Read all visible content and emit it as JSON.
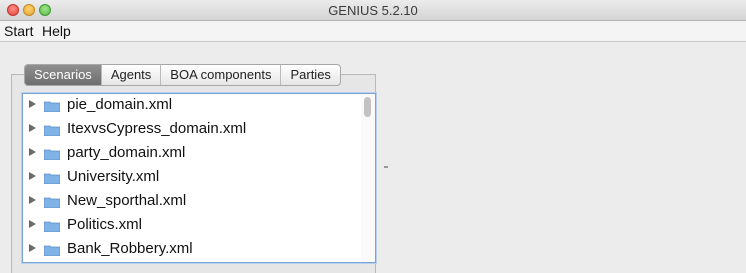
{
  "window": {
    "title": "GENIUS 5.2.10"
  },
  "menubar": {
    "items": [
      "Start",
      "Help"
    ]
  },
  "tabs": [
    {
      "label": "Scenarios",
      "active": true
    },
    {
      "label": "Agents",
      "active": false
    },
    {
      "label": "BOA components",
      "active": false
    },
    {
      "label": "Parties",
      "active": false
    }
  ],
  "scenarios": {
    "items": [
      {
        "label": "pie_domain.xml",
        "icon": "folder-icon"
      },
      {
        "label": "ItexvsCypress_domain.xml",
        "icon": "folder-icon"
      },
      {
        "label": "party_domain.xml",
        "icon": "folder-icon"
      },
      {
        "label": "University.xml",
        "icon": "folder-icon"
      },
      {
        "label": "New_sporthal.xml",
        "icon": "folder-icon"
      },
      {
        "label": "Politics.xml",
        "icon": "folder-icon"
      },
      {
        "label": "Bank_Robbery.xml",
        "icon": "folder-icon"
      }
    ]
  },
  "colors": {
    "selection_border": "#7aa3d6",
    "active_tab": "#7c7c7c",
    "folder": "#7fb3e6"
  }
}
